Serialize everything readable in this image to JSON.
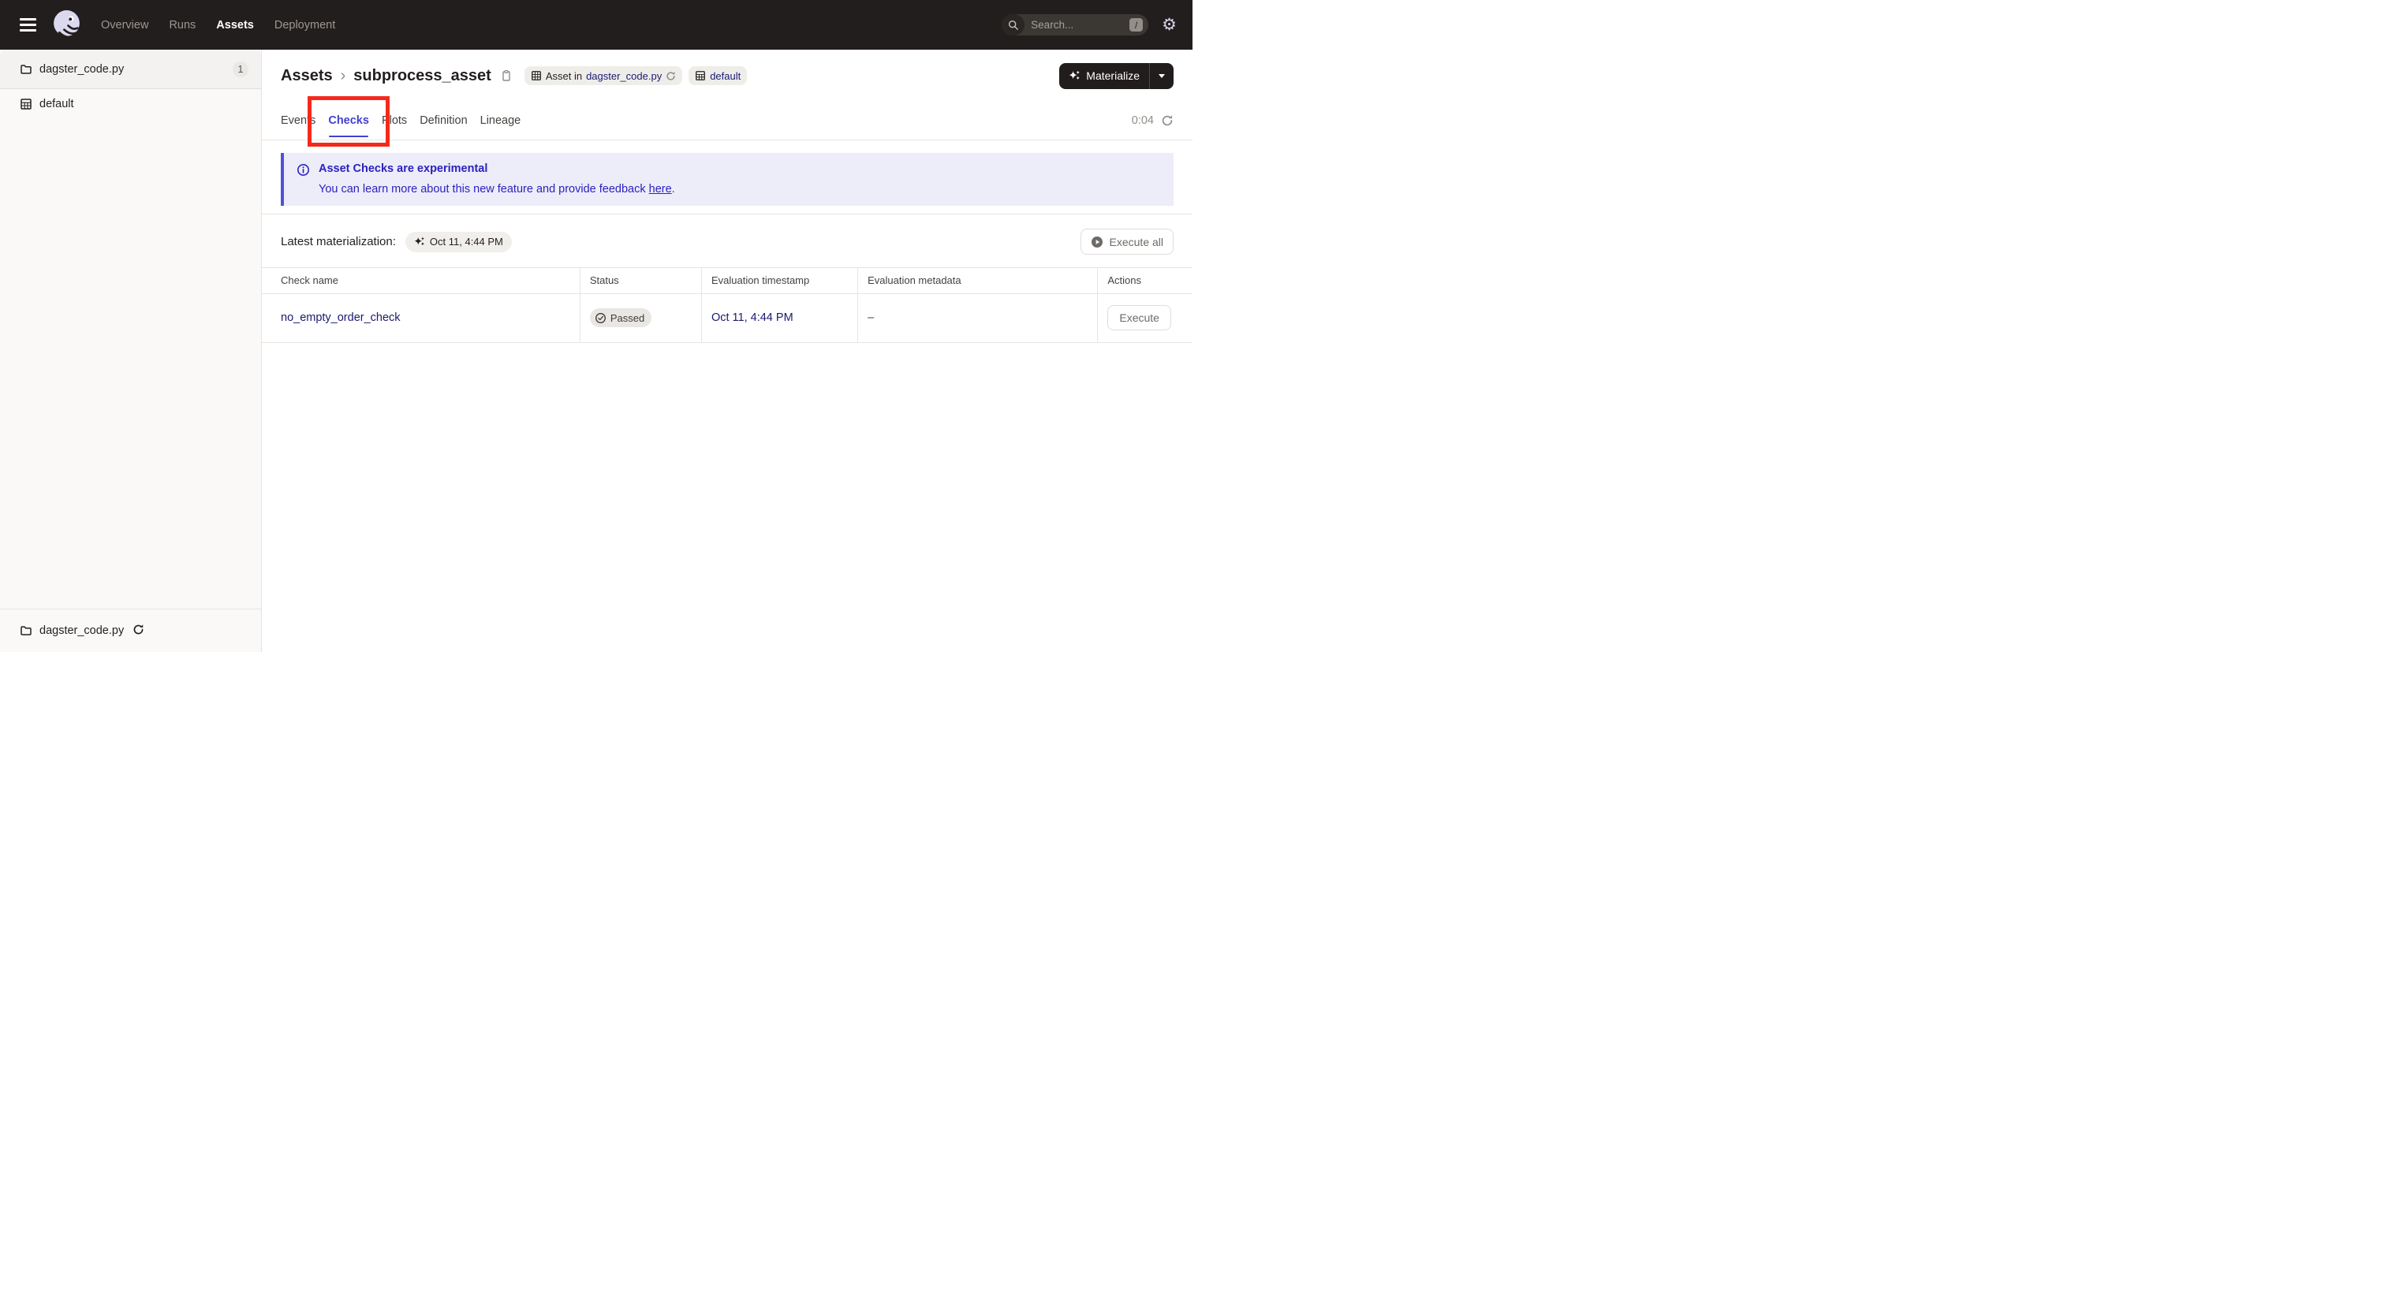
{
  "colors": {
    "topbar_bg": "#221E1D",
    "accent_blurple": "#4340D0",
    "banner_text": "#2A22BE",
    "banner_border": "#5450D9",
    "link_navy": "#1A1A6E",
    "annotation_red": "#F5291B"
  },
  "topbar": {
    "nav": [
      {
        "label": "Overview",
        "active": false
      },
      {
        "label": "Runs",
        "active": false
      },
      {
        "label": "Assets",
        "active": true
      },
      {
        "label": "Deployment",
        "active": false
      }
    ],
    "search": {
      "placeholder": "Search...",
      "shortcut_key": "/"
    }
  },
  "sidebar": {
    "items": [
      {
        "label": "dagster_code.py",
        "count": "1",
        "icon": "folder"
      },
      {
        "label": "default",
        "icon": "asset-group"
      }
    ],
    "footer": {
      "label": "dagster_code.py",
      "icon": "folder"
    }
  },
  "header": {
    "breadcrumb": {
      "root": "Assets",
      "separator": "›",
      "current": "subprocess_asset"
    },
    "asset_tag": {
      "prefix": "Asset in ",
      "link": "dagster_code.py"
    },
    "group_tag": {
      "label": "default"
    },
    "materialize": {
      "label": "Materialize"
    }
  },
  "tabs": {
    "items": [
      "Events",
      "Checks",
      "Plots",
      "Definition",
      "Lineage"
    ],
    "active": "Checks",
    "timer": "0:04"
  },
  "banner": {
    "title": "Asset Checks are experimental",
    "body": "You can learn more about this new feature and provide feedback ",
    "link_text": "here",
    "suffix": "."
  },
  "latest": {
    "label": "Latest materialization:",
    "timestamp": "Oct 11, 4:44 PM",
    "execute_all": "Execute all"
  },
  "table": {
    "headers": [
      "Check name",
      "Status",
      "Evaluation timestamp",
      "Evaluation metadata",
      "Actions"
    ],
    "rows": [
      {
        "check_name": "no_empty_order_check",
        "status": "Passed",
        "evaluation_timestamp": "Oct 11, 4:44 PM",
        "evaluation_metadata": "–",
        "action": "Execute"
      }
    ]
  },
  "annotation": {
    "type": "rectangle",
    "color": "#F5291B",
    "target": "tab-checks"
  }
}
